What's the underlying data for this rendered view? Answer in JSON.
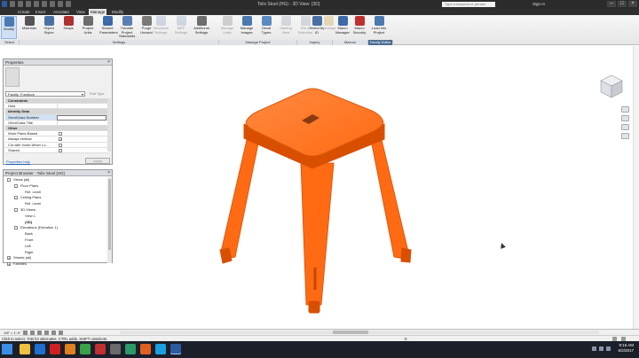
{
  "app": {
    "title": "Tolix Stool (HG) - 3D View: {3D}",
    "search_placeholder": "Type a keyword or phrase",
    "sign_in": "Sign In",
    "window_controls": [
      "–",
      "□",
      "×"
    ]
  },
  "tabs": [
    "Create",
    "Insert",
    "Annotate",
    "View",
    "Manage",
    "Modify"
  ],
  "active_tab": "Manage",
  "ribbon": {
    "modify": "Modify",
    "settings": [
      {
        "label": "Materials",
        "color": "#555555"
      },
      {
        "label": "Object Styles",
        "color": "#4a6fa5"
      },
      {
        "label": "Snaps",
        "color": "#b03030"
      },
      {
        "label": "Project Units",
        "color": "#6d6d6d"
      },
      {
        "label": "Shared Parameters",
        "color": "#3d6aa8"
      },
      {
        "label": "Transfer Project Standards",
        "color": "#5a7fb5"
      },
      {
        "label": "Purge Unused",
        "color": "#7a7a7a"
      }
    ],
    "structural": [
      {
        "label": "Structural Settings",
        "color": "#8aa0c0"
      },
      {
        "label": "MEP Settings",
        "color": "#8aa0c0"
      },
      {
        "label": "Additional Settings",
        "color": "#6d6d6d"
      }
    ],
    "manage_project": [
      {
        "label": "Manage Links",
        "color": "#8a8a8a"
      },
      {
        "label": "Manage Images",
        "color": "#4a7ab0"
      },
      {
        "label": "Decal Types",
        "color": "#5a8ac0"
      },
      {
        "label": "Starting View",
        "color": "#9aa6b6"
      }
    ],
    "inquiry": [
      {
        "label": "IDs of Selection",
        "color": "#9aa6b6"
      },
      {
        "label": "Select by ID",
        "color": "#4a6fa5"
      },
      {
        "label": "Warnings",
        "color": "#c9a640"
      }
    ],
    "macros": [
      {
        "label": "Macro Manager",
        "color": "#3d6aa8"
      },
      {
        "label": "Macro Security",
        "color": "#c03030"
      }
    ],
    "family_editor": [
      {
        "label": "Load into Project",
        "color": "#4a7ab0"
      }
    ],
    "panels": [
      "Select",
      "Settings",
      "Manage Project",
      "Inquiry",
      "Macros",
      "Family Editor"
    ]
  },
  "properties": {
    "title": "Properties",
    "family": "Family: Furniture",
    "edit_type": "Edit Type",
    "rows": [
      {
        "kind": "sec",
        "label": "Constraints"
      },
      {
        "kind": "row",
        "label": "Host"
      },
      {
        "kind": "sec",
        "label": "Identity Data"
      },
      {
        "kind": "input",
        "label": "OmniClass Number"
      },
      {
        "kind": "row",
        "label": "OmniClass Title"
      },
      {
        "kind": "sec",
        "label": "Other"
      },
      {
        "kind": "check",
        "label": "Work Plane-Based",
        "value": false
      },
      {
        "kind": "check",
        "label": "Always vertical",
        "value": true
      },
      {
        "kind": "check",
        "label": "Cut with Voids When Lo...",
        "value": false
      },
      {
        "kind": "check",
        "label": "Shared",
        "value": false
      }
    ],
    "help_link": "Properties help",
    "apply": "Apply"
  },
  "browser": {
    "title": "Project Browser - Tolix Stool (HG)",
    "nodes": [
      {
        "label": "Views (all)",
        "depth": 0,
        "toggle": "-",
        "bold": false
      },
      {
        "label": "Floor Plans",
        "depth": 1,
        "toggle": "-",
        "bold": false
      },
      {
        "label": "Ref. Level",
        "depth": 2,
        "toggle": "",
        "bold": false
      },
      {
        "label": "Ceiling Plans",
        "depth": 1,
        "toggle": "-",
        "bold": false
      },
      {
        "label": "Ref. Level",
        "depth": 2,
        "toggle": "",
        "bold": false
      },
      {
        "label": "3D Views",
        "depth": 1,
        "toggle": "-",
        "bold": false
      },
      {
        "label": "View 1",
        "depth": 2,
        "toggle": "",
        "bold": false
      },
      {
        "label": "{3D}",
        "depth": 2,
        "toggle": "",
        "bold": true
      },
      {
        "label": "Elevations (Elevation 1)",
        "depth": 1,
        "toggle": "-",
        "bold": false
      },
      {
        "label": "Back",
        "depth": 2,
        "toggle": "",
        "bold": false
      },
      {
        "label": "Front",
        "depth": 2,
        "toggle": "",
        "bold": false
      },
      {
        "label": "Left",
        "depth": 2,
        "toggle": "",
        "bold": false
      },
      {
        "label": "Right",
        "depth": 2,
        "toggle": "",
        "bold": false
      },
      {
        "label": "Sheets (all)",
        "depth": 0,
        "toggle": "+",
        "bold": false
      },
      {
        "label": "Families",
        "depth": 0,
        "toggle": "+",
        "bold": false
      }
    ]
  },
  "view_control": {
    "scale": "1/8\" = 1'-0\""
  },
  "status": {
    "message": "Click to select, TAB for alternates, CTRL adds, SHIFT unselects.",
    "zero": ":0"
  },
  "model": {
    "color": "#ff6a13",
    "shade": "#d94f00",
    "light": "#ff8a40"
  },
  "taskbar": {
    "apps": [
      {
        "name": "file-explorer",
        "color": "#f0c040"
      },
      {
        "name": "outlook",
        "color": "#1e6fd0"
      },
      {
        "name": "acrobat",
        "color": "#d02020"
      },
      {
        "name": "app-orange",
        "color": "#e08020"
      },
      {
        "name": "chrome",
        "color": "#3aa04a"
      },
      {
        "name": "autodesk-a",
        "color": "#c03030"
      },
      {
        "name": "app-gray",
        "color": "#6a6a6a"
      },
      {
        "name": "app-green",
        "color": "#2a9a6a"
      },
      {
        "name": "app-orange-2",
        "color": "#e06020"
      },
      {
        "name": "skype",
        "color": "#1aa0e0"
      },
      {
        "name": "revit",
        "color": "#2c5aa0"
      }
    ],
    "time": "9:16 AM",
    "date": "6/2/2017"
  }
}
